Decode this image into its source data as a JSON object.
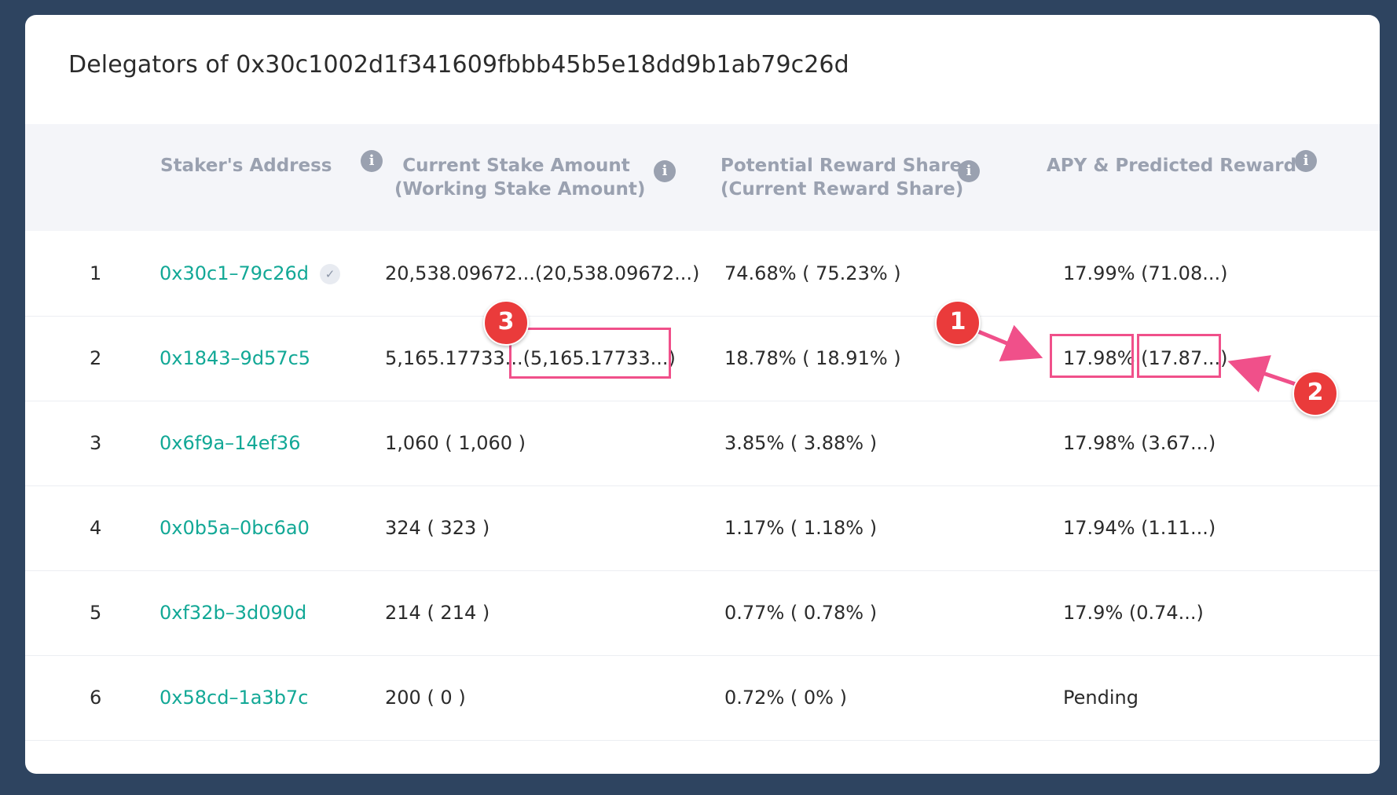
{
  "title": "Delegators of 0x30c1002d1f341609fbbb45b5e18dd9b1ab79c26d",
  "columns": {
    "address": "Staker's Address",
    "stake_line1": "Current Stake Amount",
    "stake_line2": "(Working Stake Amount)",
    "share_line1": "Potential Reward Share",
    "share_line2": "(Current Reward Share)",
    "apy": "APY & Predicted Reward"
  },
  "rows": [
    {
      "index": "1",
      "address": "0x30c1–79c26d",
      "verified": true,
      "stake": "20,538.09672...(20,538.09672...)",
      "share": "74.68% ( 75.23% )",
      "apy": "17.99% (71.08...)"
    },
    {
      "index": "2",
      "address": "0x1843–9d57c5",
      "verified": false,
      "stake": "5,165.17733...(5,165.17733...)",
      "share": "18.78% ( 18.91% )",
      "apy": "17.98% (17.87...)"
    },
    {
      "index": "3",
      "address": "0x6f9a–14ef36",
      "verified": false,
      "stake": "1,060 ( 1,060 )",
      "share": "3.85% ( 3.88% )",
      "apy": "17.98% (3.67...)"
    },
    {
      "index": "4",
      "address": "0x0b5a–0bc6a0",
      "verified": false,
      "stake": "324 ( 323 )",
      "share": "1.17% ( 1.18% )",
      "apy": "17.94% (1.11...)"
    },
    {
      "index": "5",
      "address": "0xf32b–3d090d",
      "verified": false,
      "stake": "214 ( 214 )",
      "share": "0.77% ( 0.78% )",
      "apy": "17.9% (0.74...)"
    },
    {
      "index": "6",
      "address": "0x58cd–1a3b7c",
      "verified": false,
      "stake": "200 ( 0 )",
      "share": "0.72% ( 0% )",
      "apy": "Pending"
    }
  ],
  "annotations": {
    "badge1": "1",
    "badge2": "2",
    "badge3": "3"
  },
  "colors": {
    "background": "#2e4460",
    "address_link": "#12a896",
    "highlight": "#f0508a",
    "badge": "#ea3b3b"
  },
  "icons": {
    "info": "info-icon",
    "verified": "check-circle-icon"
  }
}
